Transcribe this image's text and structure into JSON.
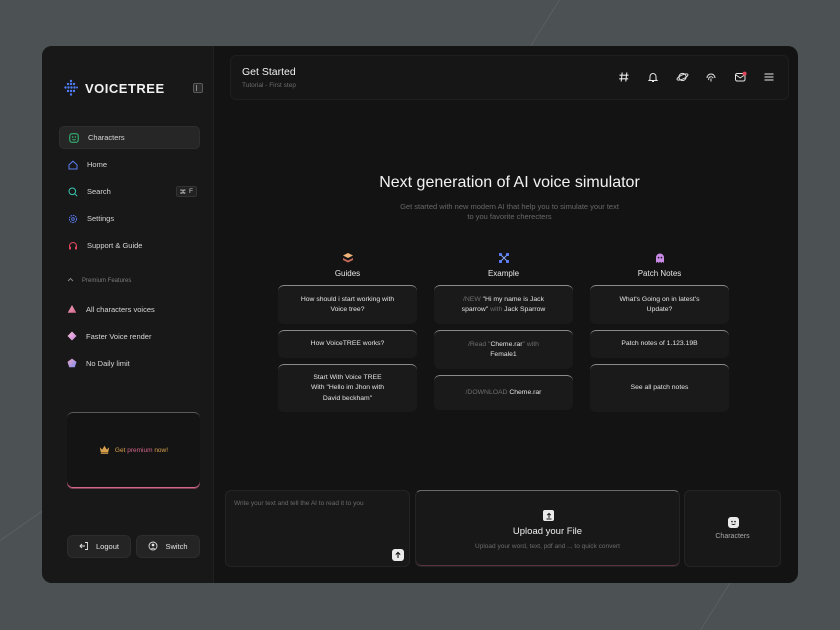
{
  "brand": {
    "name": "VOICETREE"
  },
  "sidebar": {
    "nav": [
      {
        "label": "Characters",
        "icon": "characters-icon",
        "active": true
      },
      {
        "label": "Home",
        "icon": "home-icon"
      },
      {
        "label": "Search",
        "icon": "search-icon",
        "shortcut_key": "F"
      },
      {
        "label": "Settings",
        "icon": "settings-icon"
      },
      {
        "label": "Support & Guide",
        "icon": "support-icon"
      }
    ],
    "premium_heading": "Premium Features",
    "premium_items": [
      {
        "label": "All characters voices",
        "icon": "triangle-icon"
      },
      {
        "label": "Faster Voice render",
        "icon": "diamond-icon"
      },
      {
        "label": "No Daily limit",
        "icon": "pentagon-icon"
      }
    ],
    "promo": {
      "text_a": "Get ",
      "text_b": "premium",
      "text_c": " now!"
    },
    "logout_label": "Logout",
    "switch_label": "Switch"
  },
  "header": {
    "title": "Get Started",
    "subtitle": "Tutorial - First step",
    "icons": [
      "hash-icon",
      "bell-icon",
      "planet-icon",
      "fingerprint-icon",
      "mail-icon",
      "menu-icon"
    ]
  },
  "main": {
    "headline": "Next generation of AI voice simulator",
    "subline_1": "Get started with new modern AI that help you to simulate your text",
    "subline_2": "to you favorite cherecters",
    "columns": [
      {
        "title": "Guides",
        "cards": [
          {
            "l1": "How should i start working with",
            "l2": "Voice tree?"
          },
          {
            "l1": "How VoiceTREE works?"
          },
          {
            "l1": "Start With Voice TREE",
            "l2": "With \"Hello im Jhon with",
            "l3": "David beckham\""
          }
        ]
      },
      {
        "title": "Example",
        "cards": [
          {
            "l1_dim": "/NEW ",
            "l1": "\"Hi my name is Jack",
            "l2": "sparrow\"",
            "l2_dim": " with ",
            "l2b": "Jack Sparrow"
          },
          {
            "l1_dim": "/Read \"",
            "l1": "Cheme.rar",
            "l1_dim2": "\" with",
            "l2": "Female1"
          },
          {
            "l1_dim": "/DOWNLOAD ",
            "l1": "Cheme.rar"
          }
        ]
      },
      {
        "title": "Patch Notes",
        "cards": [
          {
            "l1": "What's Going on in latest's",
            "l2": "Update?"
          },
          {
            "l1": "Patch notes of 1.123.19B"
          },
          {
            "l1": "See all patch notes"
          }
        ]
      }
    ]
  },
  "prompt": {
    "placeholder": "Write your text and tell the AI to read it to you"
  },
  "upload": {
    "title": "Upload your File",
    "subtitle": "Upload your word, text, pdf and ... to quick convert"
  },
  "characters_panel": {
    "label": "Characters"
  },
  "colors": {
    "accent": "#d4668b",
    "gold": "#d9a14e",
    "green": "#36c27a",
    "blue": "#5a7cf2"
  }
}
